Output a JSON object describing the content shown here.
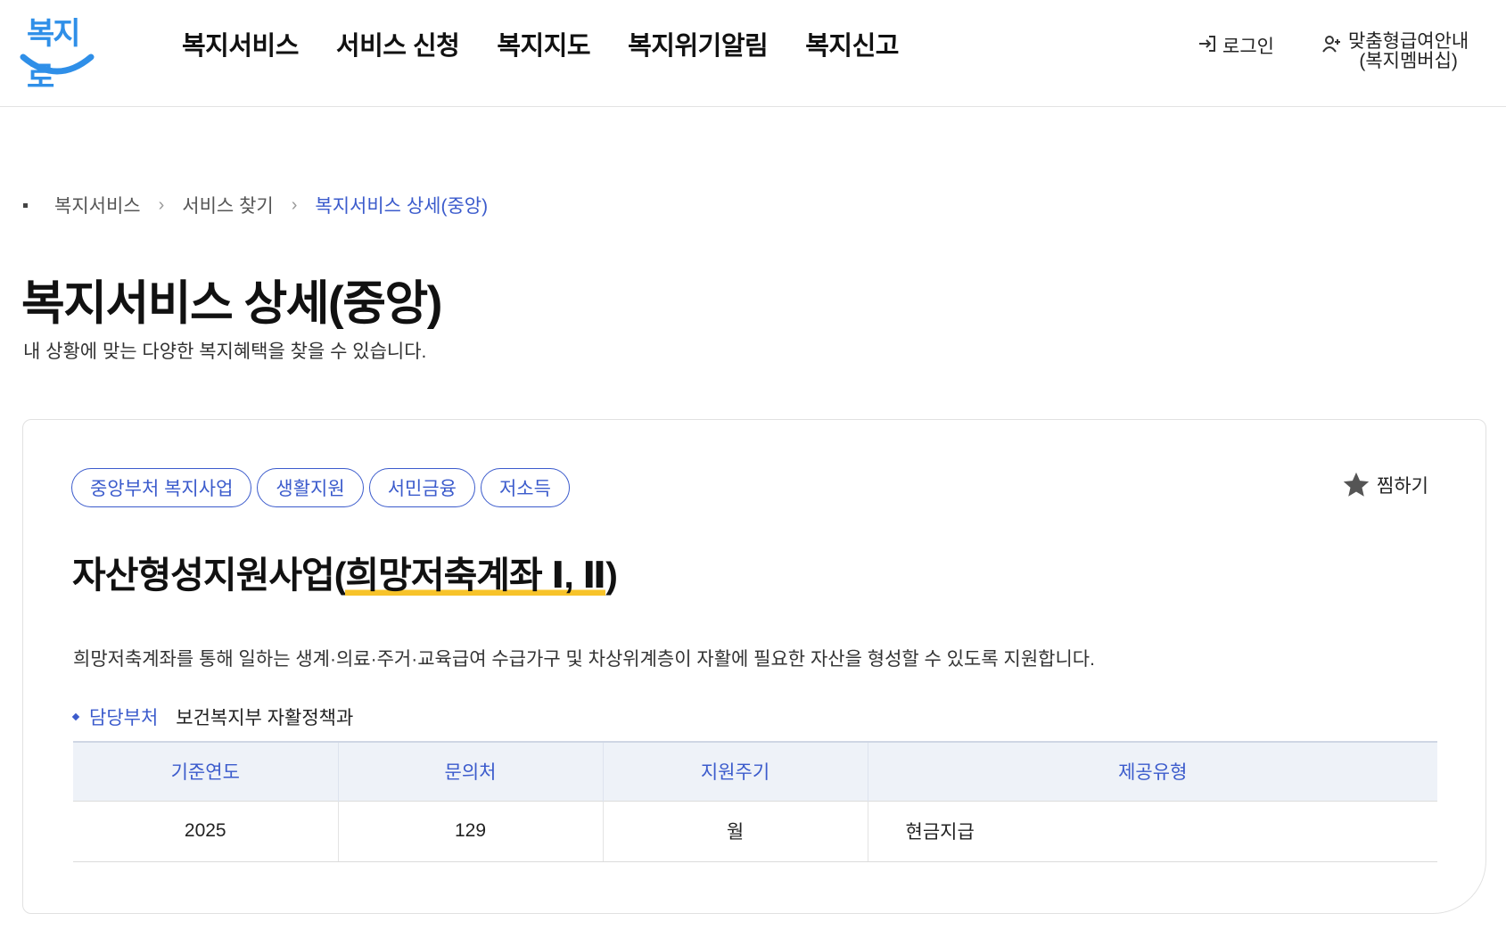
{
  "header": {
    "logo_text": "복지로",
    "nav": [
      "복지서비스",
      "서비스 신청",
      "복지지도",
      "복지위기알림",
      "복지신고"
    ],
    "login_label": "로그인",
    "member_label_line1": "맞춤형급여안내",
    "member_label_line2": "(복지멤버십)"
  },
  "breadcrumb": [
    "복지서비스",
    "서비스 찾기",
    "복지서비스 상세(중앙)"
  ],
  "page": {
    "title": "복지서비스 상세(중앙)",
    "description": "내 상황에 맞는 다양한 복지혜택을 찾을 수 있습니다."
  },
  "service": {
    "tags": [
      "중앙부처 복지사업",
      "생활지원",
      "서민금융",
      "저소득"
    ],
    "favorite_label": "찜하기",
    "title_prefix": "자산형성지원사업(",
    "title_highlight": "희망저축계좌 Ⅰ, Ⅱ",
    "title_suffix": ")",
    "description": "희망저축계좌를 통해 일하는 생계·의료·주거·교육급여 수급가구 및 차상위계층이 자활에 필요한 자산을 형성할 수 있도록 지원합니다.",
    "department_label": "담당부처",
    "department_value": "보건복지부 자활정책과",
    "table": {
      "headers": [
        "기준연도",
        "문의처",
        "지원주기",
        "제공유형"
      ],
      "row": [
        "2025",
        "129",
        "월",
        "현금지급"
      ]
    }
  },
  "colors": {
    "accent": "#3b5bcc",
    "logo_blue": "#2f8fe8",
    "highlight": "#f7c32a",
    "table_header_bg": "#eef2f8"
  },
  "icons": [
    "login-icon",
    "member-icon",
    "star-icon"
  ]
}
